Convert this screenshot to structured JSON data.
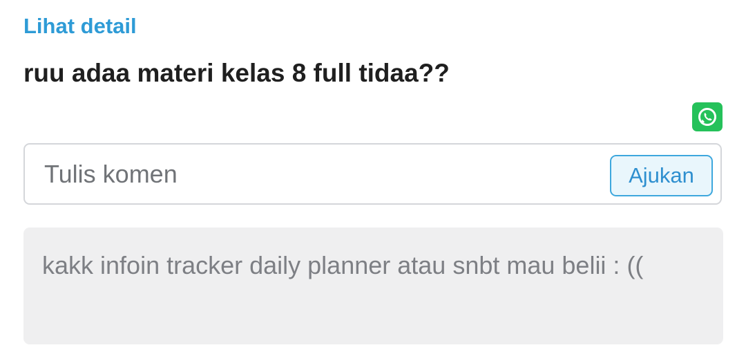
{
  "detail_link": "Lihat detail",
  "post": {
    "text": "ruu adaa materi kelas 8 full tidaa??"
  },
  "share": {
    "icon": "whatsapp-icon",
    "color": "#25c15a"
  },
  "comment": {
    "placeholder": "Tulis komen",
    "submit_label": "Ajukan"
  },
  "reply": {
    "text": "kakk infoin tracker daily planner atau snbt mau belii : (("
  },
  "colors": {
    "link": "#2e9bd6",
    "reply_bg": "#efeff0"
  }
}
